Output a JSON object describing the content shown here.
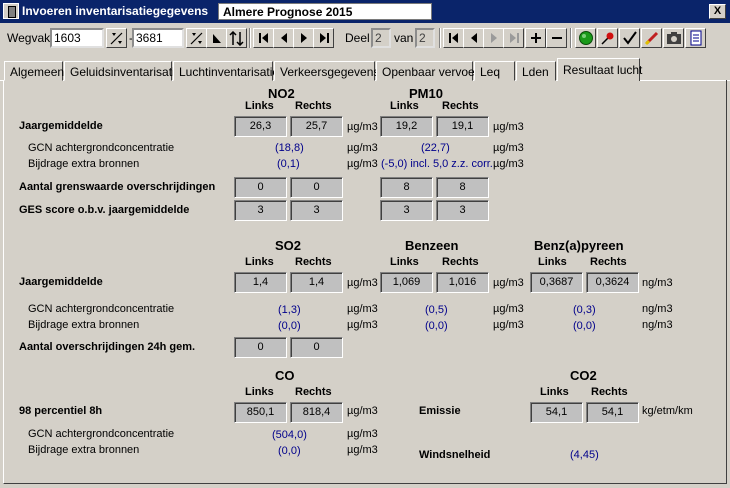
{
  "window": {
    "title": "Invoeren inventarisatiegegevens",
    "project": "Almere Prognose 2015",
    "close_label": "X"
  },
  "toolbar": {
    "wegvak_label": "Wegvak",
    "wegvak_from": "1603",
    "wegvak_sep": "-",
    "wegvak_to": "3681",
    "deel_label": "Deel",
    "deel_value": "2",
    "van_label": "van",
    "van_value": "2"
  },
  "tabs": [
    "Algemeen",
    "Geluidsinventarisatie",
    "Luchtinventarisatie",
    "Verkeersgegevens",
    "Openbaar vervoer",
    "Leq",
    "Lden",
    "Resultaat lucht"
  ],
  "labels": {
    "links": "Links",
    "rechts": "Rechts",
    "jaargemiddelde": "Jaargemiddelde",
    "gcn": "GCN achtergrondconcentratie",
    "bijdrage": "Bijdrage extra bronnen",
    "aantal_grens": "Aantal grenswaarde overschrijdingen",
    "ges": "GES score o.b.v. jaargemiddelde",
    "aantal_24h": "Aantal overschrijdingen 24h gem.",
    "p98": "98 percentiel 8h",
    "emissie": "Emissie",
    "wind": "Windsnelheid"
  },
  "units": {
    "ugm3": "µg/m3",
    "ngm3": "ng/m3",
    "kgetm": "kg/etm/km"
  },
  "no2": {
    "name": "NO2",
    "links": "26,3",
    "rechts": "25,7",
    "gcn": "(18,8)",
    "bijdrage": "(0,1)",
    "overschr_links": "0",
    "overschr_rechts": "0",
    "ges_links": "3",
    "ges_rechts": "3"
  },
  "pm10": {
    "name": "PM10",
    "links": "19,2",
    "rechts": "19,1",
    "gcn": "(22,7)",
    "bijdrage": "(-5,0) incl. 5,0 z.z. corr.",
    "overschr_links": "8",
    "overschr_rechts": "8",
    "ges_links": "3",
    "ges_rechts": "3"
  },
  "so2": {
    "name": "SO2",
    "links": "1,4",
    "rechts": "1,4",
    "gcn": "(1,3)",
    "bijdrage": "(0,0)",
    "overschr_links": "0",
    "overschr_rechts": "0"
  },
  "benzeen": {
    "name": "Benzeen",
    "links": "1,069",
    "rechts": "1,016",
    "gcn": "(0,5)",
    "bijdrage": "(0,0)"
  },
  "benzapyreen": {
    "name": "Benz(a)pyreen",
    "links": "0,3687",
    "rechts": "0,3624",
    "gcn": "(0,3)",
    "bijdrage": "(0,0)"
  },
  "co": {
    "name": "CO",
    "links": "850,1",
    "rechts": "818,4",
    "gcn": "(504,0)",
    "bijdrage": "(0,0)"
  },
  "co2": {
    "name": "CO2",
    "links": "54,1",
    "rechts": "54,1"
  },
  "wind": {
    "value": "(4,45)"
  }
}
